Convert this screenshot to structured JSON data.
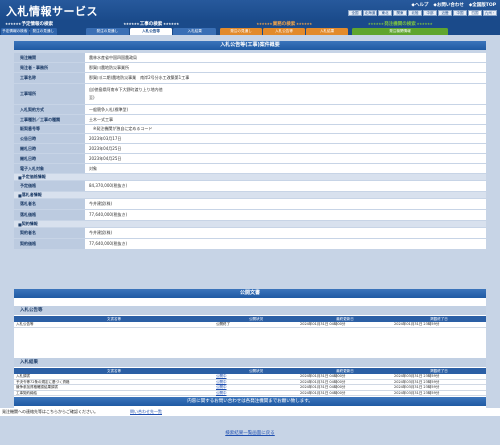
{
  "header": {
    "title": "入札情報サービス",
    "links": [
      "◆ヘルプ",
      "◆お問い合わせ",
      "◆全国版TOP"
    ],
    "regions": [
      "全国",
      "北海道",
      "東北",
      "関東",
      "北陸",
      "中部",
      "近畿",
      "中国",
      "四国",
      "九州・沖縄"
    ],
    "current_region": "四国"
  },
  "nav": [
    {
      "title": "予定情報の検索",
      "color": "#ffffff",
      "tabs": [
        "予定情報の検索",
        "発注の見通し"
      ]
    },
    {
      "title": "工事の検索",
      "color": "#ffffff",
      "tabs": [
        "発注の見通し",
        "入札公告等",
        "入札結果"
      ]
    },
    {
      "title": "業務の検索",
      "color": "#f1a44a",
      "tabs": [
        "発注の見通し",
        "入札公告等",
        "入札結果"
      ]
    },
    {
      "title": "発注機関の検索",
      "color": "#7cc243",
      "tabs": [
        "発注機関情報"
      ]
    }
  ],
  "active_tab": "入札公告等",
  "section_title": "入札公告等(工事)案件概要",
  "details": [
    {
      "label": "発注機関",
      "value": "農林水産省中国四国農政局",
      "h": 10
    },
    {
      "label": "発注者・事務所",
      "value": "那賀川農地防災事業所",
      "h": 10
    },
    {
      "label": "工事名称",
      "value": "那賀川(二期)農地防災事業　南岸2号分水工改築第1工事",
      "h": 11
    },
    {
      "label": "工事場所",
      "value": "自)徳島県阿南市下大野町渡り上り地内他\n至)",
      "h": 21
    },
    {
      "label": "入札契約方式",
      "value": "一般競争入札(標準型)",
      "h": 10
    },
    {
      "label": "工事種別／工事の種類",
      "value": "土木一式工事",
      "h": 10
    },
    {
      "label": "販契番号等",
      "value": "　※発注機関が独自に定めるコード",
      "h": 9
    },
    {
      "label": "公告日時",
      "value": "2023年03月17日",
      "h": 10
    },
    {
      "label": "開札日時",
      "value": "2023年04月25日",
      "h": 10
    },
    {
      "label": "開札日時",
      "value": "2023年04月25日",
      "h": 10
    },
    {
      "label": "電子入札対象",
      "value": "対象",
      "h": 10
    },
    {
      "sub": "予定価格情報",
      "h": 7
    },
    {
      "label": "予定価格",
      "value": "84,370,000(税抜き)",
      "h": 11
    },
    {
      "sub": "落札者情報",
      "h": 7
    },
    {
      "label": "落札者名",
      "value": "今井建設(株)",
      "h": 11
    },
    {
      "label": "落札価格",
      "value": "77,640,000(税抜き)",
      "h": 11
    },
    {
      "sub": "契約情報",
      "h": 7
    },
    {
      "label": "契約者名",
      "value": "今井建設(株)",
      "h": 11
    },
    {
      "label": "契約価格",
      "value": "77,640,000(税抜き)",
      "h": 11
    }
  ],
  "docs": {
    "title": "公開文書",
    "headers": [
      "文書名等",
      "公開状況",
      "最終更新日",
      "掲載終了日"
    ],
    "groups": [
      {
        "name": "入札公告等",
        "rows": [
          {
            "name": "入札公告等",
            "status": "公開終了",
            "updated": "2024年01月31日 04時00分",
            "end": "2024年01月31日 23時59分"
          }
        ]
      },
      {
        "name": "入札結果",
        "rows": [
          {
            "name": "入札調書",
            "status": "公開中",
            "updated": "2024年01月31日 04時00分",
            "end": "2024年03月31日 23時59分"
          },
          {
            "name": "予決令等72条の規定に基づく資格",
            "status": "公開中",
            "updated": "2024年01月31日 04時00分",
            "end": "2024年03月31日 23時59分"
          },
          {
            "name": "競争参加資格確認結果調書",
            "status": "公開中",
            "updated": "2024年01月31日 04時00分",
            "end": "2024年03月31日 23時59分"
          },
          {
            "name": "工事契約締結",
            "status": "公開中",
            "updated": "2024年01月31日 04時00分",
            "end": "2024年03月31日 23時59分"
          }
        ]
      }
    ]
  },
  "notice": "内容に関するお問い合わせは各発注機関までお願い致します。",
  "contact_text": "発注機関への連絡先等はこちらからご確認ください。",
  "contact_link": "問い合わせ先一覧",
  "back_link": "検索結果一覧画面に戻る"
}
